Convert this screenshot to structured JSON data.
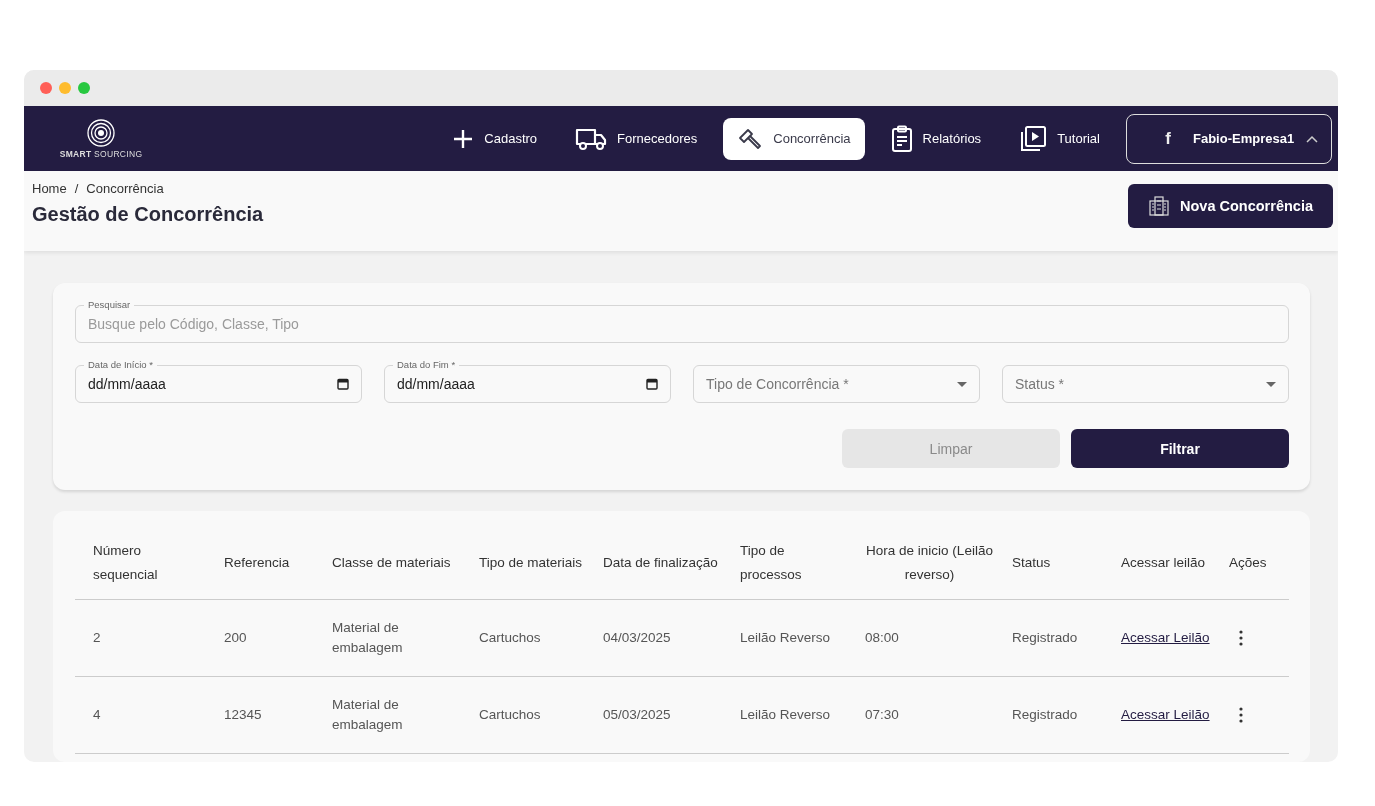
{
  "brand": {
    "name_bold": "SMART",
    "name_light": "SOURCING"
  },
  "nav": [
    {
      "label": "Cadastro",
      "selected": false
    },
    {
      "label": "Fornecedores",
      "selected": false
    },
    {
      "label": "Concorrência",
      "selected": true
    },
    {
      "label": "Relatórios",
      "selected": false
    },
    {
      "label": "Tutorial",
      "selected": false
    }
  ],
  "user": {
    "initial": "f",
    "name": "Fabio-Empresa1",
    "expanded": true
  },
  "breadcrumb": {
    "items": [
      "Home",
      "Concorrência"
    ],
    "separator": "/"
  },
  "page_title": "Gestão de Concorrência",
  "new_button": "Nova Concorrência",
  "search": {
    "label": "Pesquisar",
    "placeholder": "Busque pelo Código, Classe, Tipo"
  },
  "filters": [
    {
      "kind": "date",
      "label": "Data de Início *",
      "placeholder": "dd/mm/aaaa"
    },
    {
      "kind": "date",
      "label": "Data do Fim *",
      "placeholder": "dd/mm/aaaa"
    },
    {
      "kind": "select",
      "placeholder": "Tipo de Concorrência *"
    },
    {
      "kind": "select",
      "placeholder": "Status *"
    }
  ],
  "buttons": [
    {
      "label": "Limpar",
      "disabled": true
    },
    {
      "label": "Filtrar",
      "disabled": false
    }
  ],
  "table": {
    "columns": [
      "Número sequencial",
      "Referencia",
      "Classe de materiais",
      "Tipo de materiais",
      "Data de finalização",
      "Tipo de processos",
      "Hora de inicio (Leilão reverso)",
      "Status",
      "Acessar leilão",
      "Ações"
    ],
    "rows": [
      {
        "cells": [
          "2",
          "200",
          "Material de embalagem",
          "Cartuchos",
          "04/03/2025",
          "Leilão Reverso",
          "08:00",
          "Registrado"
        ],
        "link": "Acessar Leilão"
      },
      {
        "cells": [
          "4",
          "12345",
          "Material de embalagem",
          "Cartuchos",
          "05/03/2025",
          "Leilão Reverso",
          "07:30",
          "Registrado"
        ],
        "link": "Acessar Leilão"
      }
    ]
  }
}
